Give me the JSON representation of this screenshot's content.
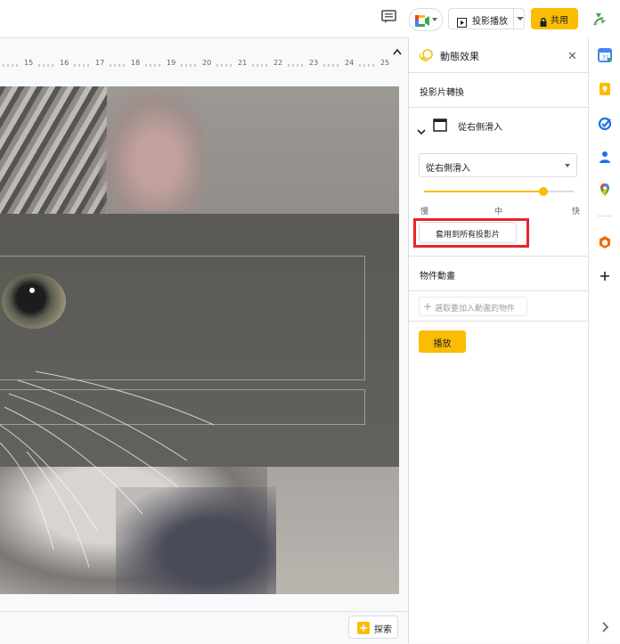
{
  "toolbar": {
    "slideshow_label": "投影播放",
    "share_label": "共用"
  },
  "ruler": {
    "labels": [
      "15",
      "16",
      "17",
      "18",
      "19",
      "20",
      "21",
      "22",
      "23",
      "24",
      "25"
    ]
  },
  "panel": {
    "title": "動態效果",
    "slide_transition_heading": "投影片轉換",
    "transition_name": "從右側滑入",
    "transition_select_value": "從右側滑入",
    "speed_slow": "慢",
    "speed_medium": "中",
    "speed_fast": "快",
    "speed_level": 0.8,
    "apply_all_label": "套用到所有投影片",
    "object_animation_heading": "物件動畫",
    "add_animation_label": "選取要加入動畫的物件",
    "play_label": "播放"
  },
  "bottom": {
    "explore_label": "探索"
  },
  "colors": {
    "accent": "#fbbc04",
    "highlight": "#e8242b"
  },
  "icons": [
    "comment-icon",
    "meet-icon",
    "play-icon",
    "lock-icon",
    "avatar",
    "collapse-icon",
    "motion-icon",
    "close-icon",
    "chevron-down-icon",
    "transition-icon",
    "plus-icon",
    "explore-icon",
    "calendar-icon",
    "keep-icon",
    "tasks-icon",
    "contacts-icon",
    "maps-icon",
    "office-addon-icon",
    "add-addon-icon",
    "expand-panel-icon"
  ]
}
